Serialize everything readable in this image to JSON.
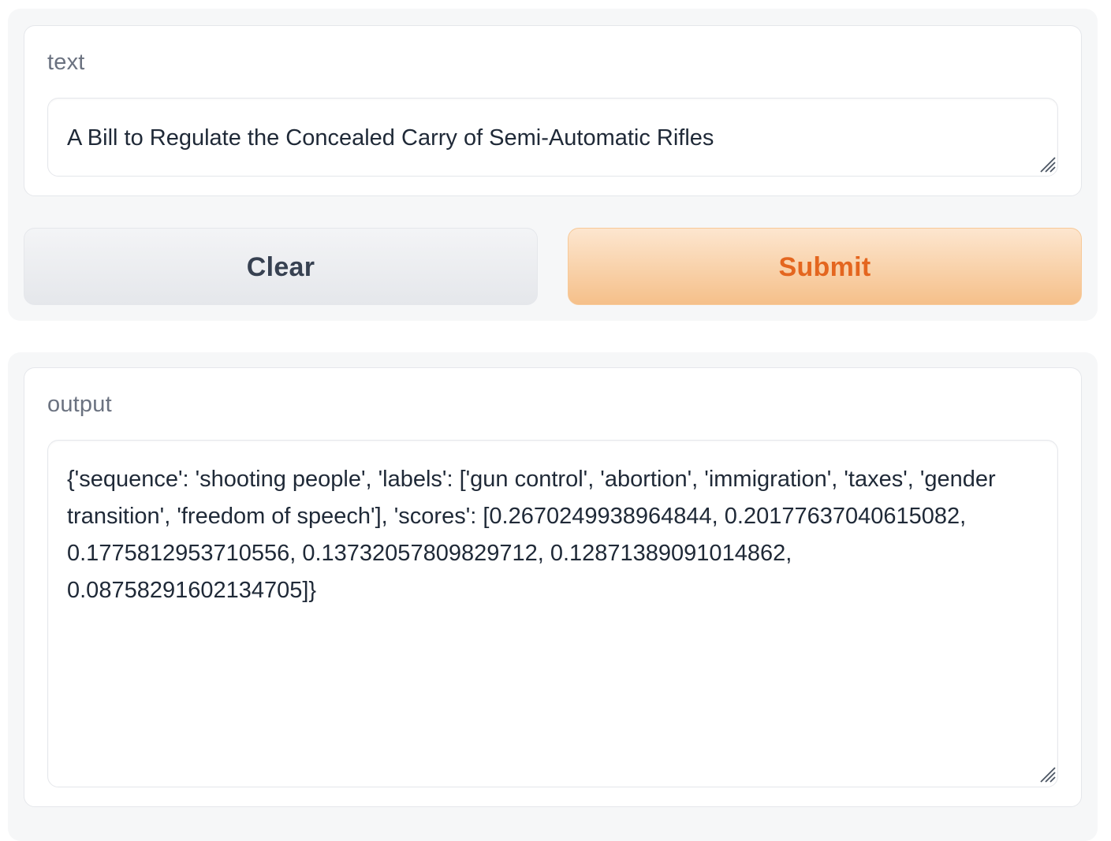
{
  "input": {
    "label": "text",
    "value": "A Bill to Regulate the Concealed Carry of Semi-Automatic Rifles"
  },
  "buttons": {
    "clear_label": "Clear",
    "submit_label": "Submit"
  },
  "output": {
    "label": "output",
    "value": "{'sequence': 'shooting people', 'labels': ['gun control', 'abortion', 'immigration', 'taxes', 'gender transition', 'freedom of speech'], 'scores': [0.2670249938964844, 0.20177637040615082, 0.1775812953710556, 0.13732057809829712, 0.12871389091014862, 0.08758291602134705]}"
  },
  "colors": {
    "submit_text": "#e4661f",
    "submit_bg_top": "#fde6cf",
    "submit_bg_bottom": "#f5c08a",
    "clear_text": "#374151",
    "label_text": "#6b7280",
    "panel_bg": "#f6f7f8"
  },
  "icons": {
    "resize_handle": "resize-handle-icon"
  }
}
